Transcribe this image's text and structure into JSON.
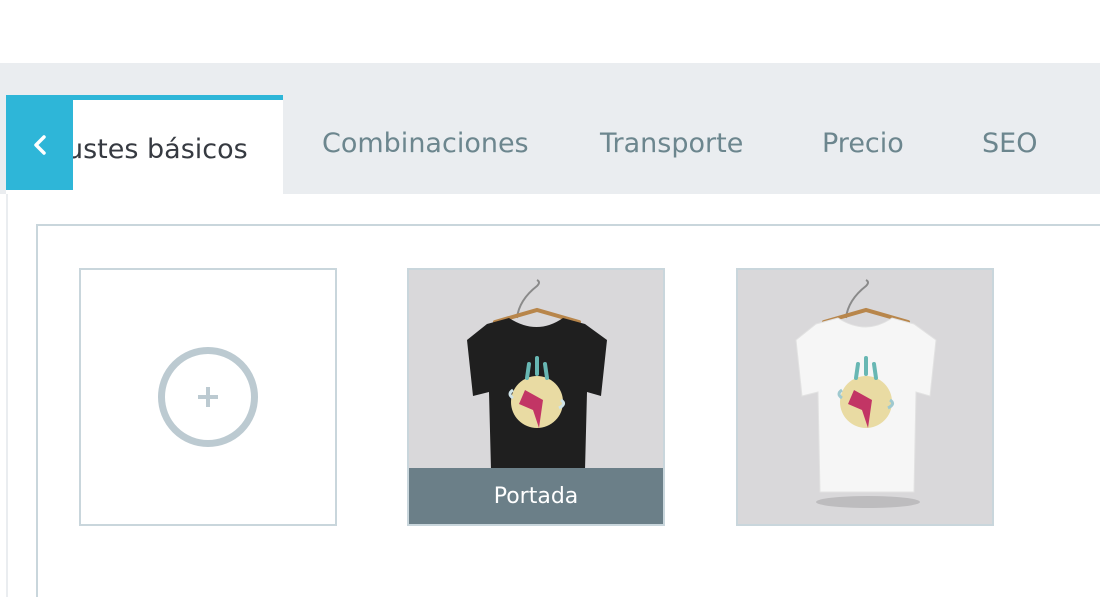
{
  "tabs": {
    "active_label": "ustes básicos",
    "items": [
      {
        "label": "Combinaciones"
      },
      {
        "label": "Transporte"
      },
      {
        "label": "Precio"
      },
      {
        "label": "SEO"
      }
    ]
  },
  "images": {
    "add_icon": "plus-circle-icon",
    "items": [
      {
        "shirt_color": "black",
        "cover_label": "Portada"
      },
      {
        "shirt_color": "white"
      }
    ]
  },
  "colors": {
    "accent": "#2eb6d8",
    "tab_bar": "#eaedf0",
    "tab_text": "#6c868e",
    "cover_band": "#6b7f88"
  }
}
